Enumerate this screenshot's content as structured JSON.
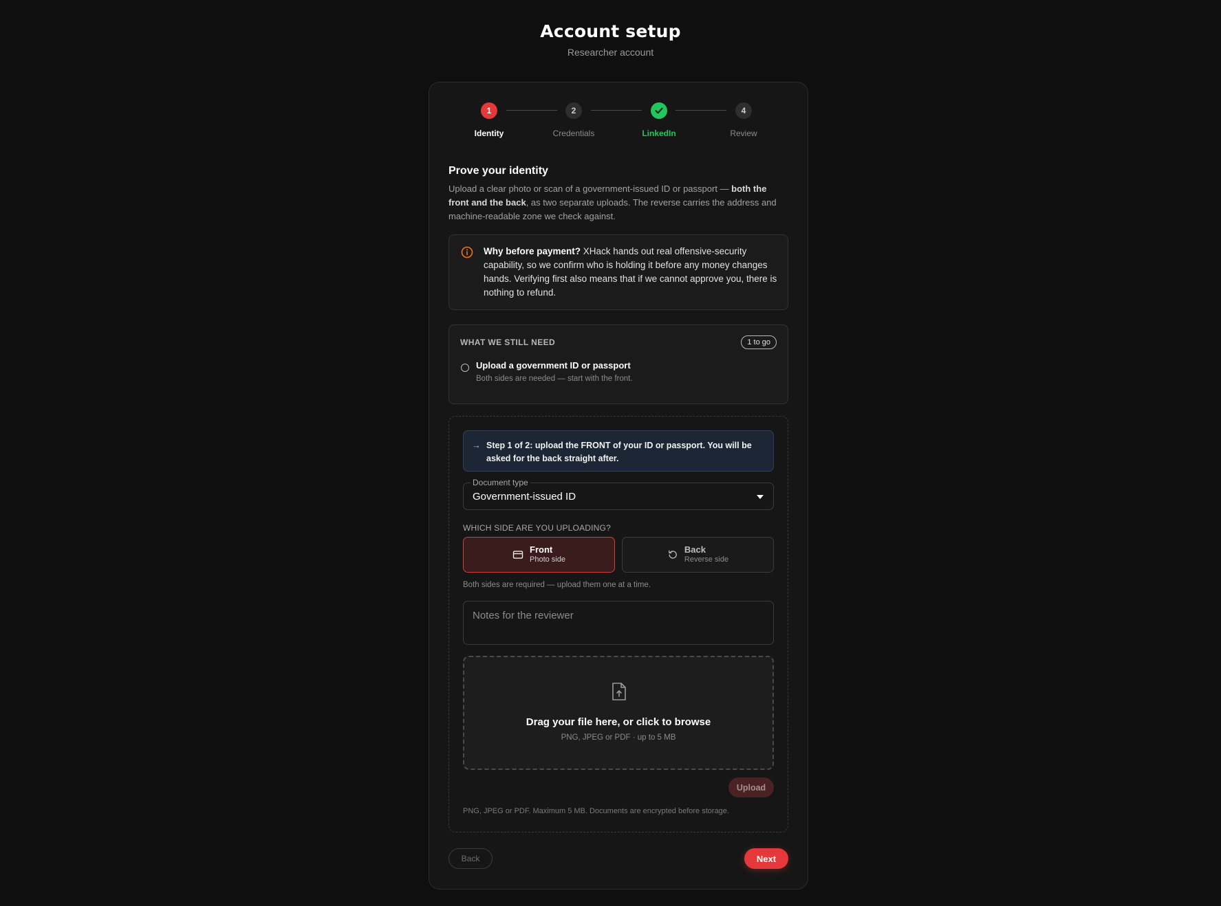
{
  "header": {
    "title": "Account setup",
    "subtitle": "Researcher account"
  },
  "stepper": {
    "steps": [
      {
        "number": "1",
        "label": "Identity",
        "state": "active",
        "color": "#e5383b"
      },
      {
        "number": "2",
        "label": "Credentials",
        "state": "pending",
        "color": "#2e2e2e"
      },
      {
        "number": "✓",
        "label": "LinkedIn",
        "state": "complete",
        "color": "#22c55e"
      },
      {
        "number": "4",
        "label": "Review",
        "state": "pending",
        "color": "#2e2e2e"
      }
    ]
  },
  "section": {
    "title": "Prove your identity",
    "desc_part1": "Upload a clear photo or scan of a government-issued ID or passport — ",
    "desc_bold": "both the front and the back",
    "desc_part2": ", as two separate uploads. The reverse carries the address and machine-readable zone we check against."
  },
  "info": {
    "icon": "info-circle-icon",
    "bold": "Why before payment?",
    "text": " XHack hands out real offensive-security capability, so we confirm who is holding it before any money changes hands. Verifying first also means that if we cannot approve you, there is nothing to refund."
  },
  "needs": {
    "title": "WHAT WE STILL NEED",
    "badge": "1 to go",
    "item_title": "Upload a government ID or passport",
    "item_sub": "Both sides are needed — start with the front."
  },
  "upload": {
    "banner": "Step 1 of 2: upload the FRONT of your ID or passport. You will be asked for the back straight after.",
    "doc_type_label": "Document type",
    "doc_type_value": "Government-issued ID",
    "which_side": "WHICH SIDE ARE YOU UPLOADING?",
    "front_title": "Front",
    "front_sub": "Photo side",
    "back_title": "Back",
    "back_sub": "Reverse side",
    "both_sides_note": "Both sides are required — upload them one at a time.",
    "notes_placeholder": "Notes for the reviewer",
    "dropzone_title": "Drag your file here, or click to browse",
    "dropzone_sub": "PNG, JPEG or PDF · up to 5 MB",
    "upload_button": "Upload",
    "footer_note": "PNG, JPEG or PDF. Maximum 5 MB. Documents are encrypted before storage."
  },
  "nav": {
    "back": "Back",
    "next": "Next"
  },
  "colors": {
    "accent": "#e5383b",
    "success": "#22c55e",
    "warning": "#f97316",
    "background": "#0f0f0f"
  }
}
